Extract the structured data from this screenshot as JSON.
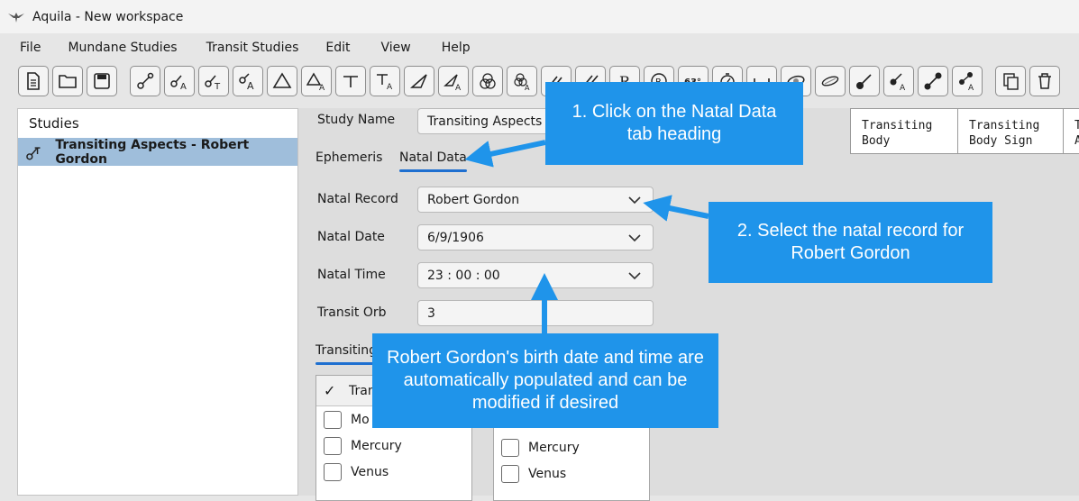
{
  "window": {
    "title": "Aquila - New workspace"
  },
  "menu": [
    "File",
    "Mundane Studies",
    "Transit Studies",
    "Edit",
    "View",
    "Help"
  ],
  "toolbar_icons": [
    "new-file-icon",
    "open-folder-icon",
    "save-icon",
    "conjunction-icon",
    "aspect-a-icon",
    "aspect-t-icon",
    "sextile-a-icon",
    "triangle-icon",
    "triangle-a-icon",
    "t-square-icon",
    "t-square-a-icon",
    "wedge-icon",
    "wedge-a-icon",
    "venn-icon",
    "venn-a-icon",
    "double-slash-icon",
    "double-slash-alt-icon",
    "retrograde-r-icon",
    "registered-icon",
    "degrees-63-icon",
    "timer-icon",
    "bracket-icon",
    "ring-icon",
    "ellipse-icon",
    "planet-line-icon",
    "planet-line-a-icon",
    "dumbbell-icon",
    "dumbbell-a-icon",
    "copy-icon",
    "trash-icon"
  ],
  "studies": {
    "header": "Studies",
    "items": [
      {
        "label": "Transiting Aspects - Robert Gordon"
      }
    ]
  },
  "form": {
    "study_name_label": "Study Name",
    "study_name_value": "Transiting Aspects -",
    "tabs": [
      "Ephemeris",
      "Natal Data"
    ],
    "natal_record_label": "Natal Record",
    "natal_record_value": "Robert Gordon",
    "natal_date_label": "Natal Date",
    "natal_date_value": "6/9/1906",
    "natal_time_label": "Natal Time",
    "natal_time_value": "23 : 00 : 00",
    "transit_orb_label": "Transit Orb",
    "transit_orb_value": "3",
    "section_tab": "Transiting",
    "list_left": {
      "header": "Tran",
      "items": [
        "Mo",
        "Mercury",
        "Venus"
      ]
    },
    "list_right": {
      "items": [
        "Mercury",
        "Venus"
      ]
    }
  },
  "grid": {
    "columns": [
      "Transiting\nBody",
      "Transiting\nBody Sign",
      "T\nA"
    ]
  },
  "callouts": {
    "c1": "1. Click on the Natal Data tab heading",
    "c2": "2. Select the natal record for Robert Gordon",
    "c3": "Robert Gordon's birth date and time are automatically populated and can be modified if desired"
  },
  "colors": {
    "callout": "#1f94ea",
    "selection": "#9fbedb",
    "tab_underline": "#1e6fd0"
  }
}
